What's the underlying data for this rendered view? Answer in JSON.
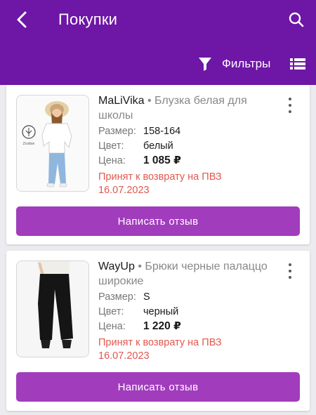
{
  "header": {
    "title": "Покупки",
    "back_icon": "back-arrow-icon",
    "search_icon": "search-icon",
    "filters_label": "Фильтры",
    "filter_icon": "funnel-icon",
    "list_icon": "list-view-icon",
    "background_color": "#6e16a6"
  },
  "orders": [
    {
      "brand": "MaLiVika",
      "separator": "•",
      "name": "Блузка белая для школы",
      "size_label": "Размер:",
      "size": "158-164",
      "color_label": "Цвет:",
      "color": "белый",
      "price_label": "Цена:",
      "price": "1 085 ₽",
      "status_line1": "Принят к возврату на ПВЗ",
      "status_line2": "16.07.2023",
      "button_label": "Написать отзыв",
      "logo_text": "Zcotton"
    },
    {
      "brand": "WayUp",
      "separator": "•",
      "name": "Брюки черные палаццо широкие",
      "size_label": "Размер:",
      "size": "S",
      "color_label": "Цвет:",
      "color": "черный",
      "price_label": "Цена:",
      "price": "1 220 ₽",
      "status_line1": "Принят к возврату на ПВЗ",
      "status_line2": "16.07.2023",
      "button_label": "Написать отзыв"
    }
  ],
  "colors": {
    "accent_button": "#a13cbc",
    "status_text": "#e0584f"
  }
}
